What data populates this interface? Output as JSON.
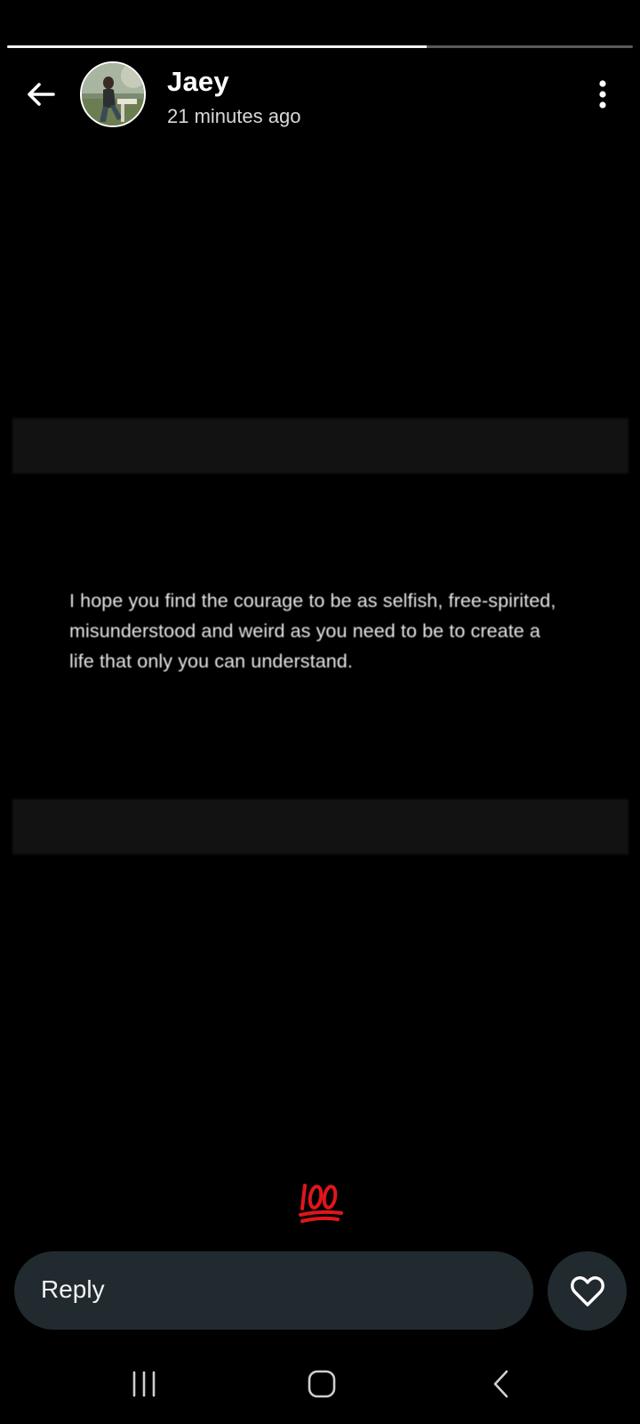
{
  "story": {
    "progress": 0.67,
    "quote": "I hope you find the courage to be as selfish, free-spirited, misunderstood and weird as you need to be to create a life that only you can understand.",
    "reaction_emoji": "hundred-points-icon"
  },
  "header": {
    "name": "Jaey",
    "time": "21 minutes ago"
  },
  "reply": {
    "placeholder": "Reply"
  },
  "colors": {
    "background": "#000000",
    "reply_bar": "#212a2f",
    "progress_fill": "#f2f2f2",
    "progress_track": "#5a5a5a",
    "emoji_red": "#e0161b"
  }
}
